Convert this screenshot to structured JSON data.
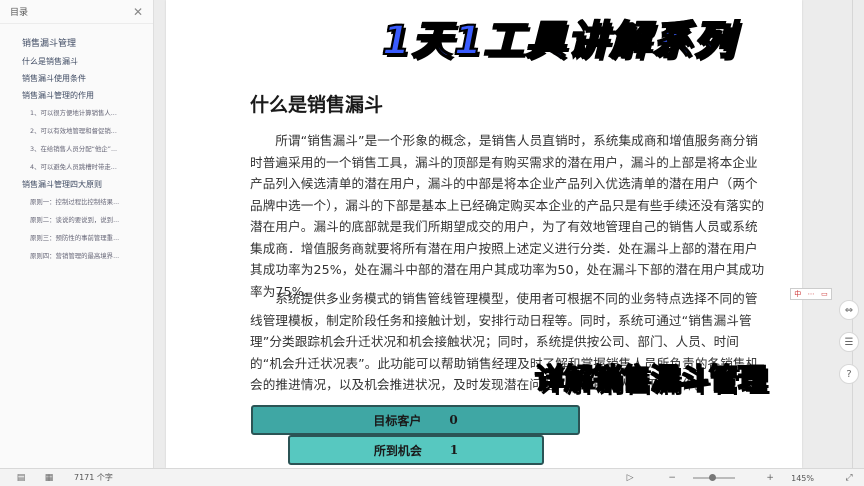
{
  "sidebar": {
    "title": "目录",
    "items": [
      {
        "label": "销售漏斗管理",
        "level": "h1"
      },
      {
        "label": "什么是销售漏斗",
        "level": "h2"
      },
      {
        "label": "销售漏斗使用条件",
        "level": "h2"
      },
      {
        "label": "销售漏斗管理的作用",
        "level": "h2"
      },
      {
        "label": "1、可以很方便地计算销售人...",
        "level": "sub"
      },
      {
        "label": "2、可以有效地管理和督促销...",
        "level": "sub"
      },
      {
        "label": "3、在给销售人员分配“他企”...",
        "level": "sub"
      },
      {
        "label": "4、可以避免人员跳槽时带走...",
        "level": "sub"
      },
      {
        "label": "销售漏斗管理四大原则",
        "level": "h2"
      },
      {
        "label": "原则一：控制过程比控制结果...",
        "level": "sub"
      },
      {
        "label": "原则二：谈说的要说到，说到...",
        "level": "sub"
      },
      {
        "label": "原则三：预防性的事前管理重...",
        "level": "sub"
      },
      {
        "label": "原则四：营销管理的最高境界...",
        "level": "sub"
      }
    ]
  },
  "doc": {
    "heading": "什么是销售漏斗",
    "paragraph1": "所谓“销售漏斗”是一个形象的概念，是销售人员直销时，系统集成商和增值服务商分销时普遍采用的一个销售工具，漏斗的顶部是有购买需求的潜在用户，漏斗的上部是将本企业产品列入候选清单的潜在用户，漏斗的中部是将本企业产品列入优选清单的潜在用户（两个品牌中选一个），漏斗的下部是基本上已经确定购买本企业的产品只是有些手续还没有落实的潜在用户。漏斗的底部就是我们所期望成交的用户，为了有效地管理自己的销售人员或系统集成商．增值服务商就要将所有潜在用户按照上述定义进行分类．处在漏斗上部的潜在用户其成功率为25%，处在漏斗中部的潜在用户其成功率为50，处在漏斗下部的潜在用户其成功率为75%。",
    "paragraph2": "系统提供多业务模式的销售管线管理模型，使用者可根据不同的业务特点选择不同的管线管理模板，制定阶段任务和接触计划，安排行动日程等。同时，系统可通过“销售漏斗管理”分类跟踪机会升迁状况和机会接触状况；同时，系统提供按公司、部门、人员、时间的“机会升迁状况表”。此功能可以帮助销售经理及时了解和掌握销售人员所负责的各销售机会的推进情况，以及机会推进状况，及时发现潜在问题，指导销售人员开展工作。",
    "funnel": [
      {
        "label": "目标客户",
        "value": "0"
      },
      {
        "label": "所到机会",
        "value": "1"
      }
    ]
  },
  "overlay": {
    "banner": "1天1工具讲解系列",
    "caption": "详解销售漏斗管理"
  },
  "right_tools": {
    "mini_bar": [
      "中",
      "⋯",
      "▭"
    ],
    "buttons": [
      "⇔",
      "☰",
      "?"
    ]
  },
  "status": {
    "word_count": "7171 个字",
    "zoom": "145%",
    "zoom_level": 0.45
  },
  "colors": {
    "banner": "#3a5cff",
    "caption": "#fff15a",
    "funnel_top": "#3fa7a4",
    "funnel_second": "#57c8c0"
  }
}
